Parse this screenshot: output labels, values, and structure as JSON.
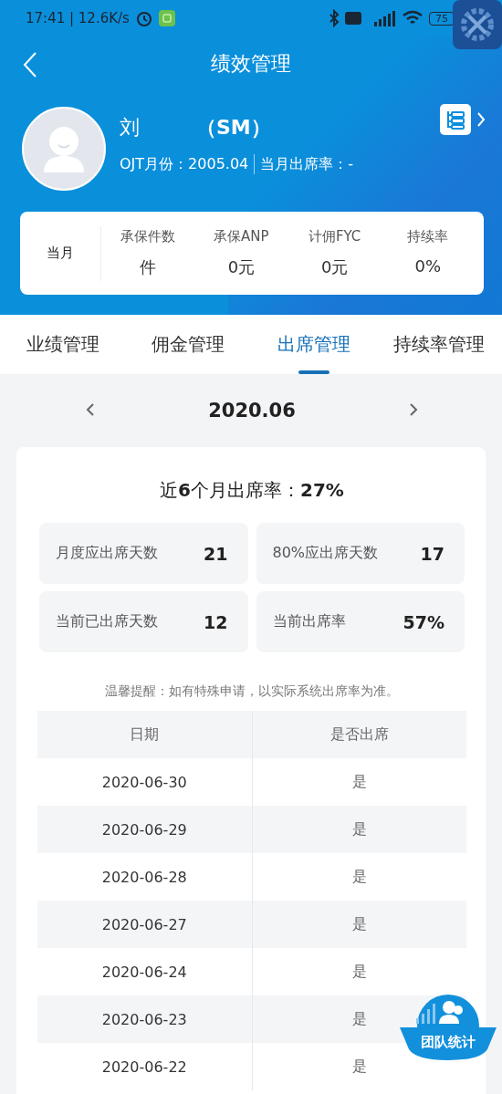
{
  "status_bar": {
    "time": "17:41 | 12.6K/s",
    "battery": "75"
  },
  "header": {
    "title": "绩效管理"
  },
  "profile": {
    "name": "刘",
    "role": "（SM）",
    "ojt_label": "OJT月份：2005.04",
    "attendance_label": "当月出席率：-"
  },
  "summary": {
    "period": "当月",
    "stats": [
      {
        "label": "承保件数",
        "value": "件"
      },
      {
        "label": "承保ANP",
        "value": "0元"
      },
      {
        "label": "计佣FYC",
        "value": "0元"
      },
      {
        "label": "持续率",
        "value": "0%"
      }
    ]
  },
  "tabs": [
    {
      "label": "业绩管理",
      "selected": false
    },
    {
      "label": "佣金管理",
      "selected": false
    },
    {
      "label": "出席管理",
      "selected": true
    },
    {
      "label": "持续率管理",
      "selected": false
    }
  ],
  "month": "2020.06",
  "attendance": {
    "headline": "近**6**个月出席率：**27%**",
    "metrics": [
      {
        "label": "月度应出席天数",
        "value": "21"
      },
      {
        "label": "80%应出席天数",
        "value": "17"
      },
      {
        "label": "当前已出席天数",
        "value": "12"
      },
      {
        "label": "当前出席率",
        "value": "57%"
      }
    ],
    "notice": "温馨提醒：如有特殊申请，以实际系统出席率为准。"
  },
  "table": {
    "columns": [
      "日期",
      "是否出席"
    ],
    "rows": [
      [
        "2020-06-30",
        "是"
      ],
      [
        "2020-06-29",
        "是"
      ],
      [
        "2020-06-28",
        "是"
      ],
      [
        "2020-06-27",
        "是"
      ],
      [
        "2020-06-24",
        "是"
      ],
      [
        "2020-06-23",
        "是"
      ],
      [
        "2020-06-22",
        "是"
      ]
    ]
  },
  "fab": {
    "label": "团队统计"
  }
}
